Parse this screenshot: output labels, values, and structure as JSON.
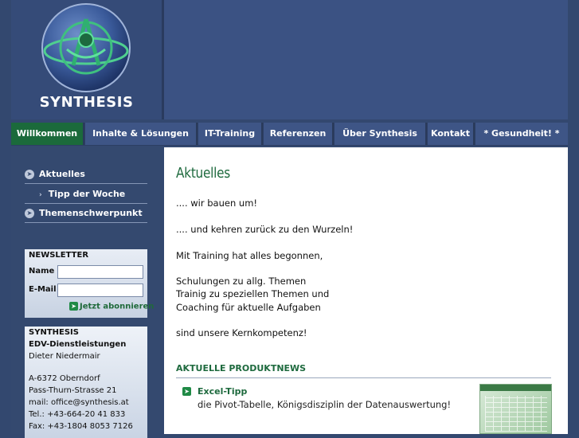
{
  "brand": {
    "name": "SYNTHESIS"
  },
  "nav": {
    "items": [
      {
        "label": "Willkommen",
        "active": true
      },
      {
        "label": "Inhalte & Lösungen",
        "active": false
      },
      {
        "label": "IT-Training",
        "active": false
      },
      {
        "label": "Referenzen",
        "active": false
      },
      {
        "label": "Über Synthesis",
        "active": false
      },
      {
        "label": "Kontakt",
        "active": false
      },
      {
        "label": "* Gesundheit! *",
        "active": false
      }
    ]
  },
  "sidebar": {
    "items": [
      {
        "label": "Aktuelles"
      },
      {
        "label": "Tipp der Woche"
      },
      {
        "label": "Themenschwerpunkt"
      }
    ]
  },
  "newsletter": {
    "title": "NEWSLETTER",
    "name_label": "Name",
    "email_label": "E-Mail",
    "name_value": "",
    "email_value": "",
    "submit_label": "Jetzt abonnieren"
  },
  "contact": {
    "lines": [
      "SYNTHESIS",
      "EDV-Dienstleistungen",
      "Dieter Niedermair",
      "A-6372 Oberndorf",
      "Pass-Thurn-Strasse 21",
      "mail: office@synthesis.at",
      "Tel.: +43-664-20 41 833",
      "Fax: +43-1804 8053 7126"
    ]
  },
  "main": {
    "title": "Aktuelles",
    "paragraphs": [
      ".... wir bauen um!",
      ".... und kehren zurück zu den Wurzeln!",
      "Mit Training hat alles begonnen,",
      "Schulungen zu allg. Themen",
      "Trainig zu speziellen Themen und",
      "Coaching für aktuelle Aufgaben",
      "sind unsere Kernkompetenz!"
    ],
    "news_heading": "AKTUELLE PRODUKTNEWS",
    "news_item": {
      "title": "Excel-Tipp",
      "description": "die Pivot-Tabelle, Königsdisziplin der Datenauswertung!"
    }
  },
  "colors": {
    "header_bg": "#3b5283",
    "nav_active": "#1b6a3b",
    "accent_green": "#1e6a3e"
  }
}
